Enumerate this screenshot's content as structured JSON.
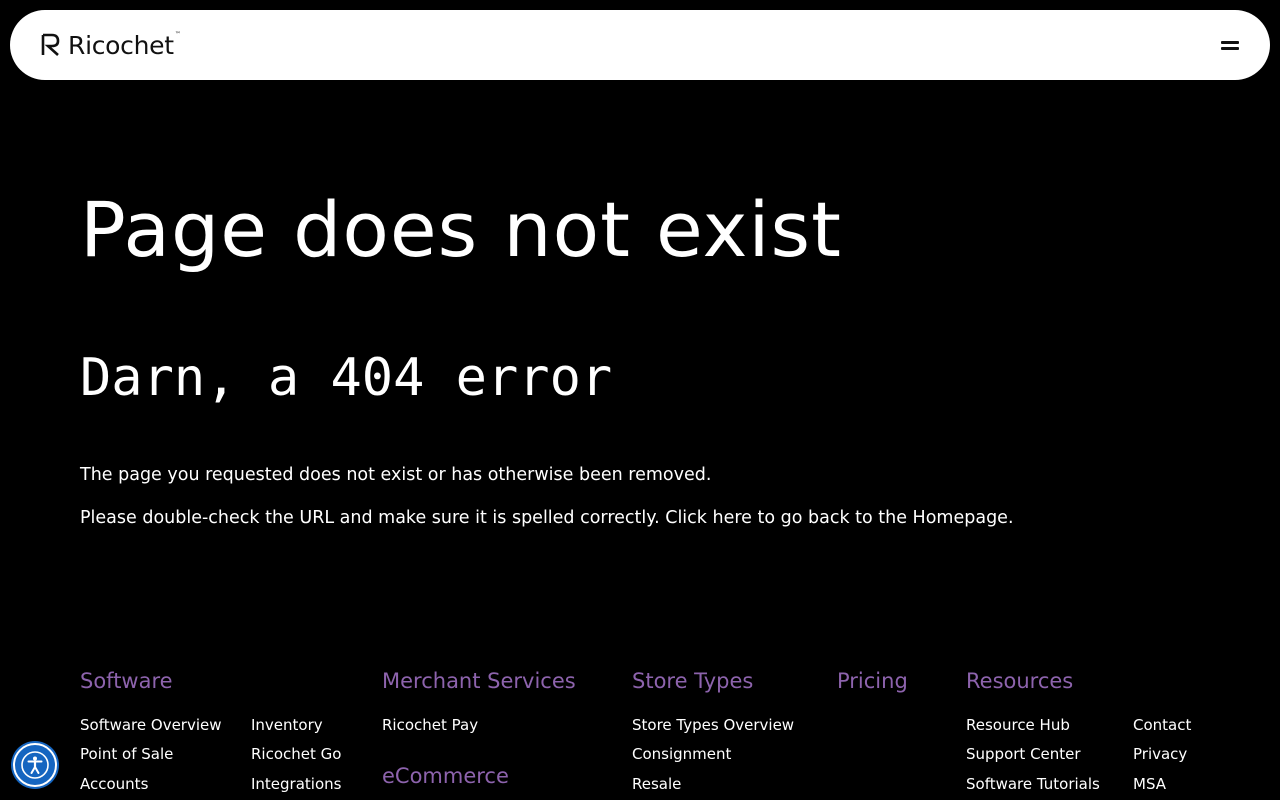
{
  "header": {
    "logo_text": "Ricochet",
    "logo_tm": "™",
    "menu_icon": "hamburger-icon"
  },
  "main": {
    "title": "Page does not exist",
    "subtitle": "Darn, a 404 error",
    "message_line1": "The page you requested does not exist or has otherwise been removed.",
    "message_line2": "Please double-check the URL and make sure it is spelled correctly. Click here to go back to the Homepage."
  },
  "footer": {
    "software": {
      "heading": "Software",
      "links": [
        "Software Overview",
        "Point of Sale",
        "Accounts",
        "Inventory",
        "Ricochet Go",
        "Integrations"
      ]
    },
    "merchant_services": {
      "heading": "Merchant Services",
      "links": [
        "Ricochet Pay"
      ]
    },
    "ecommerce": {
      "heading": "eCommerce"
    },
    "store_types": {
      "heading": "Store Types",
      "links": [
        "Store Types Overview",
        "Consignment",
        "Resale"
      ]
    },
    "pricing": {
      "heading": "Pricing"
    },
    "resources": {
      "heading": "Resources",
      "links": [
        "Resource Hub",
        "Support Center",
        "Software Tutorials",
        "Contact",
        "Privacy",
        "MSA"
      ]
    }
  },
  "accessibility": {
    "icon": "accessibility-icon"
  },
  "colors": {
    "background": "#000000",
    "header_bg": "#ffffff",
    "footer_heading": "#8d63ad",
    "accessibility_button": "#1565c0"
  }
}
